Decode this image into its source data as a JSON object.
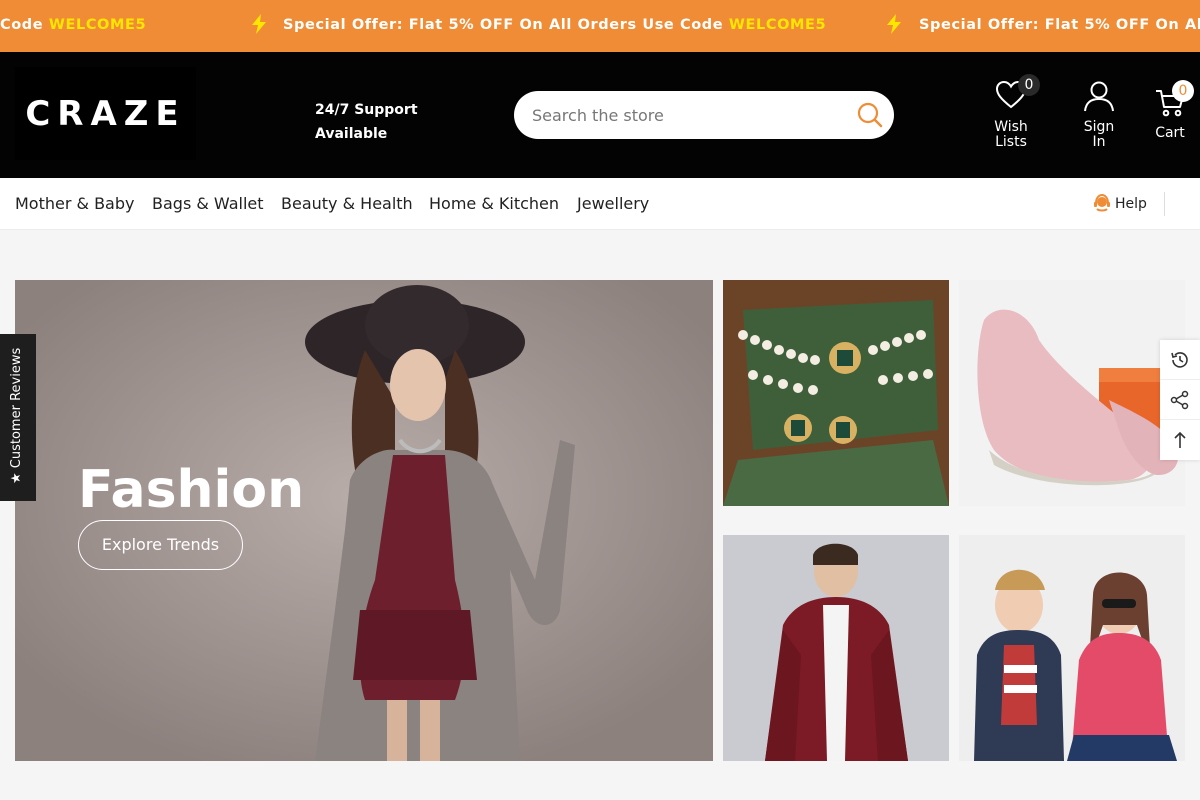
{
  "announcement": {
    "prefix_partial": "Code",
    "code": "WELCOME5",
    "message": "Special Offer: Flat 5% OFF On All Orders Use Code",
    "message_partial": "Special Offer: Flat 5% OFF On All Ord"
  },
  "header": {
    "logo_text": "CRAZE",
    "support_text": "24/7 Support Available",
    "search": {
      "placeholder": "Search the store"
    },
    "wishlist": {
      "label": "Wish Lists",
      "count": "0"
    },
    "signin": {
      "label": "Sign In"
    },
    "cart": {
      "label": "Cart",
      "count": "0"
    }
  },
  "nav": {
    "items": [
      "Mother & Baby",
      "Bags & Wallet",
      "Beauty & Health",
      "Home & Kitchen",
      "Jewellery"
    ],
    "help": "Help"
  },
  "hero": {
    "title": "Fashion",
    "button": "Explore Trends"
  },
  "side": {
    "reviews": "★ Customer Reviews"
  },
  "colors": {
    "announce_bg": "#ef8c35",
    "code": "#ffe600",
    "header_bg": "#030303",
    "accent": "#ef8c35"
  },
  "icons": [
    "bolt-icon",
    "search-icon",
    "heart-icon",
    "user-icon",
    "cart-icon",
    "help-icon",
    "history-icon",
    "share-icon",
    "arrow-up-icon"
  ]
}
